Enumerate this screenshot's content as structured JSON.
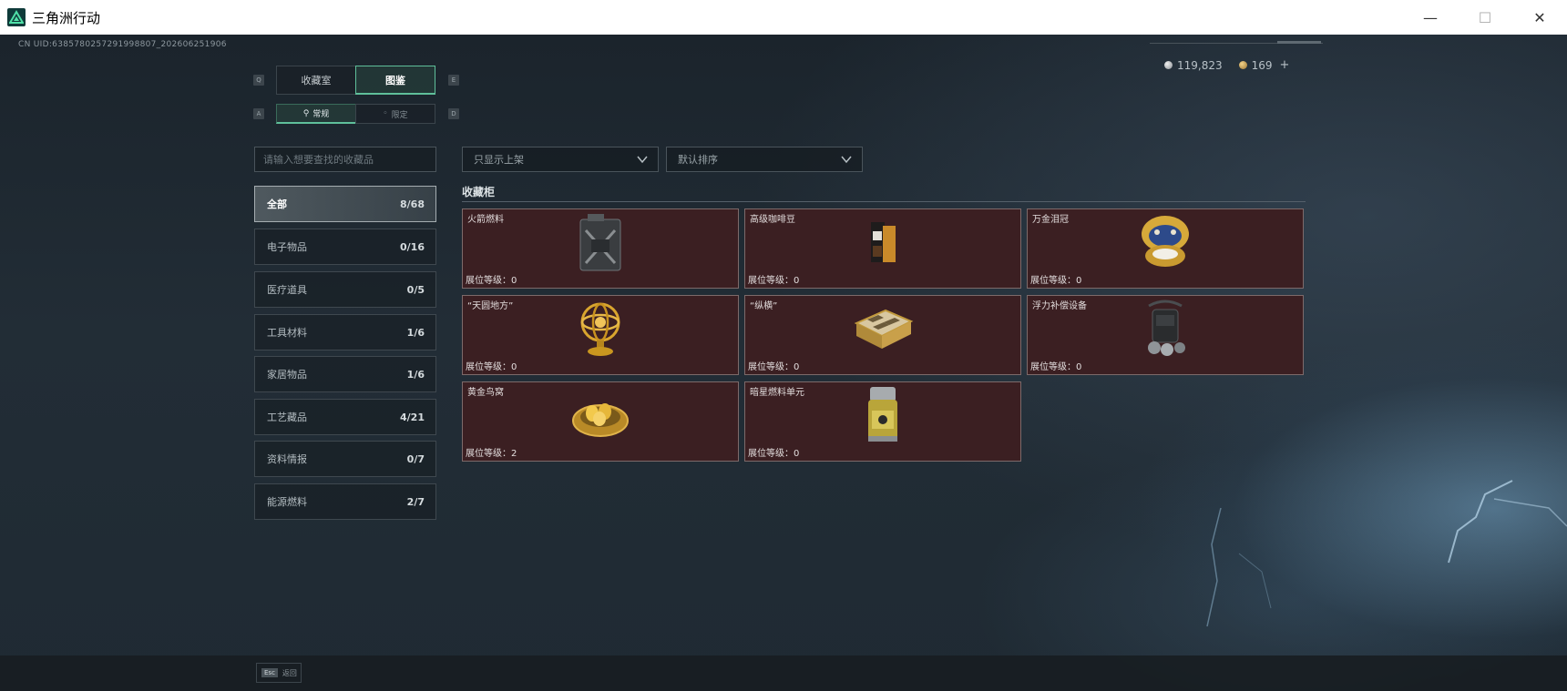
{
  "window": {
    "title": "三角洲行动",
    "controls": {
      "minimize": "—",
      "maximize": "☐",
      "close": "✕"
    }
  },
  "uid": "CN UID:6385780257291998807_202606251906",
  "currency": {
    "silver": "119,823",
    "gold": "169",
    "add": "+"
  },
  "tabs": {
    "main": [
      {
        "label": "收藏室",
        "key": "Q",
        "active": false
      },
      {
        "label": "图鉴",
        "key": "E",
        "active": true
      }
    ],
    "sub": [
      {
        "label": "常规",
        "icon": "flask-icon",
        "key": "A",
        "active": true
      },
      {
        "label": "限定",
        "icon": "limited-icon",
        "key": "D",
        "active": false
      }
    ]
  },
  "search": {
    "placeholder": "请输入想要查找的收藏品"
  },
  "categories": [
    {
      "label": "全部",
      "count": "8/68",
      "active": true
    },
    {
      "label": "电子物品",
      "count": "0/16",
      "active": false
    },
    {
      "label": "医疗道具",
      "count": "0/5",
      "active": false
    },
    {
      "label": "工具材料",
      "count": "1/6",
      "active": false
    },
    {
      "label": "家居物品",
      "count": "1/6",
      "active": false
    },
    {
      "label": "工艺藏品",
      "count": "4/21",
      "active": false
    },
    {
      "label": "资料情报",
      "count": "0/7",
      "active": false
    },
    {
      "label": "能源燃料",
      "count": "2/7",
      "active": false
    }
  ],
  "filters": {
    "show_filter": "只显示上架",
    "sort": "默认排序"
  },
  "section": {
    "title": "收藏柜"
  },
  "items": [
    {
      "name": "火箭燃料",
      "level": "展位等级：0",
      "icon": "fuel-can-icon"
    },
    {
      "name": "高级咖啡豆",
      "level": "展位等级：0",
      "icon": "coffee-bag-icon"
    },
    {
      "name": "万金泪冠",
      "level": "展位等级：0",
      "icon": "jeweled-egg-icon"
    },
    {
      "name": "“天圆地方”",
      "level": "展位等级：0",
      "icon": "armillary-sphere-icon"
    },
    {
      "name": "“纵横”",
      "level": "展位等级：0",
      "icon": "chess-box-icon"
    },
    {
      "name": "浮力补偿设备",
      "level": "展位等级：0",
      "icon": "bcd-device-icon"
    },
    {
      "name": "黄金鸟窝",
      "level": "展位等级：2",
      "icon": "golden-nest-icon"
    },
    {
      "name": "暗星燃料单元",
      "level": "展位等级：0",
      "icon": "fuel-cell-icon"
    }
  ],
  "footer": {
    "esc_key": "Esc",
    "back_label": "返回"
  }
}
